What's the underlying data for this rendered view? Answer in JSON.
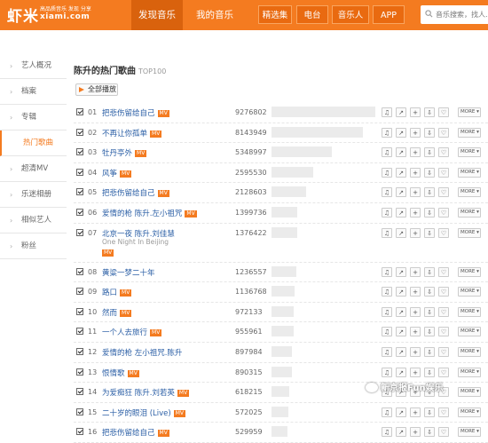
{
  "logo": {
    "text": "虾米",
    "slogan": "高品质音乐 发现 分享",
    "domain": "xiami.com"
  },
  "nav": {
    "main": [
      "发现音乐",
      "我的音乐"
    ],
    "sub": [
      "精选集",
      "电台",
      "音乐人",
      "APP"
    ]
  },
  "search": {
    "placeholder": "音乐搜索，找人..."
  },
  "sidebar": {
    "items": [
      "艺人概况",
      "档案",
      "专辑",
      "热门歌曲",
      "超清MV",
      "乐迷相册",
      "相似艺人",
      "粉丝"
    ],
    "active_index": 3
  },
  "page": {
    "title": "陈升的热门歌曲",
    "tag": "TOP100",
    "play_all": "全部播放"
  },
  "mv_label": "MV",
  "more_label": "MORE",
  "songs": [
    {
      "num": "01",
      "title": "把悲伤留给自己",
      "mv": true,
      "plays": "9276802",
      "popularity": 1.0
    },
    {
      "num": "02",
      "title": "不再让你孤单",
      "mv": true,
      "plays": "8143949",
      "popularity": 0.88
    },
    {
      "num": "03",
      "title": "牡丹亭外",
      "mv": true,
      "plays": "5348997",
      "popularity": 0.58
    },
    {
      "num": "04",
      "title": "风筝",
      "mv": true,
      "plays": "2595530",
      "popularity": 0.4
    },
    {
      "num": "05",
      "title": "把悲伤留给自己",
      "mv": true,
      "plays": "2128603",
      "popularity": 0.33
    },
    {
      "num": "06",
      "title": "爱情的枪 陈升.左小祖咒",
      "mv": true,
      "plays": "1399736",
      "popularity": 0.25
    },
    {
      "num": "07",
      "title": "北京一夜 陈升.刘佳慧",
      "sub": "One Night In Beijing",
      "mv": true,
      "plays": "1376422",
      "popularity": 0.25
    },
    {
      "num": "08",
      "title": "黄粱一梦二十年",
      "mv": false,
      "plays": "1236557",
      "popularity": 0.24
    },
    {
      "num": "09",
      "title": "路口",
      "mv": true,
      "plays": "1136768",
      "popularity": 0.22
    },
    {
      "num": "10",
      "title": "然而",
      "mv": true,
      "plays": "972133",
      "popularity": 0.21
    },
    {
      "num": "11",
      "title": "一个人去旅行",
      "mv": true,
      "plays": "955961",
      "popularity": 0.21
    },
    {
      "num": "12",
      "title": "爱情的枪 左小祖咒.陈升",
      "mv": false,
      "plays": "897984",
      "popularity": 0.2
    },
    {
      "num": "13",
      "title": "恨情歌",
      "mv": true,
      "plays": "890315",
      "popularity": 0.2
    },
    {
      "num": "14",
      "title": "为爱痴狂 陈升.刘若英",
      "mv": true,
      "plays": "618215",
      "popularity": 0.17
    },
    {
      "num": "15",
      "title": "二十岁的眼泪 (Live)",
      "mv": true,
      "plays": "572025",
      "popularity": 0.16
    },
    {
      "num": "16",
      "title": "把悲伤留给自己",
      "mv": true,
      "plays": "529959",
      "popularity": 0.15
    }
  ],
  "watermark": "新京报Fun娱乐",
  "colors": {
    "accent": "#f47b20",
    "link": "#2a5ea5"
  }
}
